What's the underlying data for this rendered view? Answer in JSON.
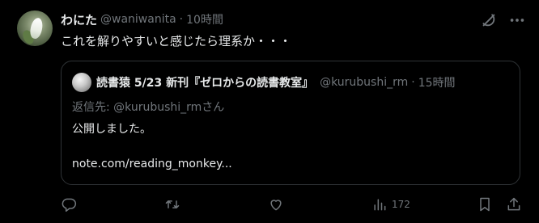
{
  "tweet": {
    "display_name": "わにた",
    "handle": "@waniwanita",
    "separator": "·",
    "time": "10時間",
    "text": "これを解りやすいと感じたら理系か・・・"
  },
  "quote": {
    "display_name": "読書猿 5/23 新刊『ゼロからの読書教室』",
    "handle": "@kurubushi_rm",
    "separator": "·",
    "time": "15時間",
    "reply_to": "返信先: @kurubushi_rmさん",
    "line1": "公開しました。",
    "line2": "note.com/reading_monkey..."
  },
  "actions": {
    "views_count": "172"
  },
  "icons": {
    "grok": "grok-icon",
    "more": "more-icon",
    "reply": "reply-icon",
    "retweet": "retweet-icon",
    "like": "like-icon",
    "views": "views-icon",
    "bookmark": "bookmark-icon",
    "share": "share-icon"
  },
  "colors": {
    "background": "#000000",
    "text_primary": "#e7e9ea",
    "text_secondary": "#71767b",
    "border": "#2f3336"
  }
}
